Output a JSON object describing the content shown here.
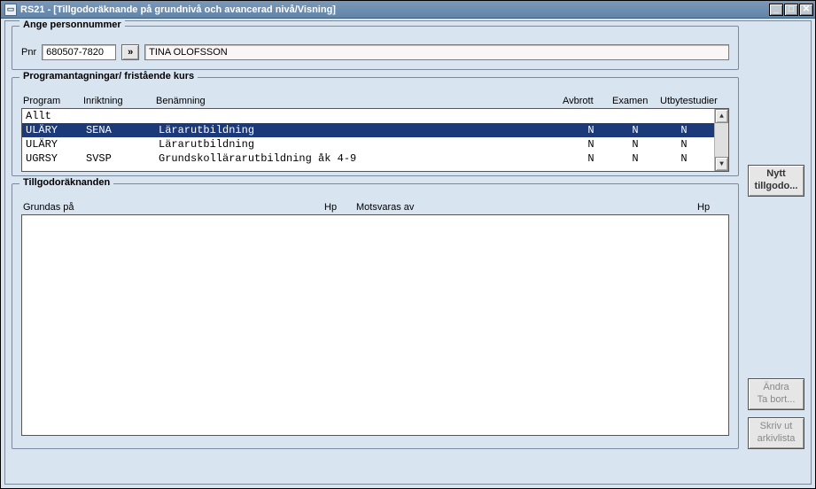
{
  "window": {
    "title": "RS21 - [Tillgodoräknande på grundnivå och avancerad nivå/Visning]"
  },
  "sections": {
    "pnr_legend": "Ange personnummer",
    "prog_legend": "Programantagningar/ fristående kurs",
    "cred_legend": "Tillgodoräknanden"
  },
  "pnr": {
    "label": "Pnr",
    "value": "680507-7820",
    "go_symbol": "»",
    "name_value": "TINA OLOFSSON"
  },
  "prog": {
    "headers": {
      "program": "Program",
      "inriktning": "Inriktning",
      "benamning": "Benämning",
      "avbrott": "Avbrott",
      "examen": "Examen",
      "utbytesstudier": "Utbytestudier"
    },
    "rows": [
      {
        "program": "Allt",
        "inriktning": "",
        "benamning": "",
        "av": "",
        "ex": "",
        "ut": "",
        "sel": false
      },
      {
        "program": "ULÄRY",
        "inriktning": "SENA",
        "benamning": "Lärarutbildning",
        "av": "N",
        "ex": "N",
        "ut": "N",
        "sel": true
      },
      {
        "program": "ULÄRY",
        "inriktning": "",
        "benamning": "Lärarutbildning",
        "av": "N",
        "ex": "N",
        "ut": "N",
        "sel": false
      },
      {
        "program": "UGRSY",
        "inriktning": "SVSP",
        "benamning": "Grundskollärarutbildning åk 4-9",
        "av": "N",
        "ex": "N",
        "ut": "N",
        "sel": false
      }
    ],
    "scroll": {
      "up": "▲",
      "down": "▼"
    }
  },
  "cred": {
    "headers": {
      "grundas": "Grundas på",
      "hp1": "Hp",
      "motsvaras": "Motsvaras av",
      "hp2": "Hp"
    }
  },
  "buttons": {
    "nytt_l1": "Nytt",
    "nytt_l2": "tillgodo...",
    "andra_l1": "Ändra",
    "andra_l2": "Ta bort...",
    "skriv_l1": "Skriv ut",
    "skriv_l2": "arkivlista"
  },
  "winbtn": {
    "min": "_",
    "max": "□",
    "close": "✕"
  }
}
